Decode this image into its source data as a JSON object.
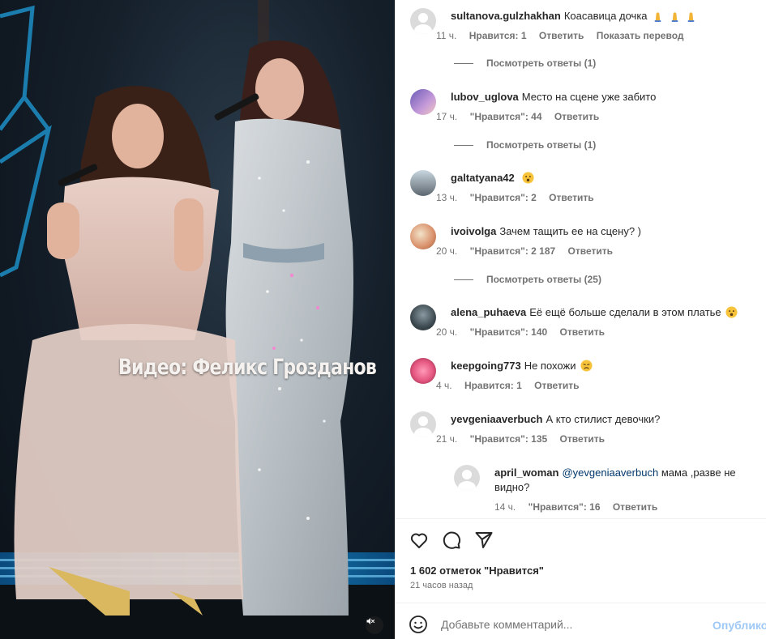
{
  "media": {
    "caption": "Видео: Феликс Грозданов"
  },
  "comments": [
    {
      "username": "sultanova.gulzhakhan",
      "text": "Коасавица дочка",
      "emoji": "praying-hands",
      "time": "11 ч.",
      "likes": "Нравится: 1",
      "reply_label": "Ответить",
      "translate_label": "Показать перевод",
      "view_replies": "Посмотреть ответы (1)"
    },
    {
      "username": "lubov_uglova",
      "text": "Место на сцене уже забито",
      "time": "17 ч.",
      "likes": "\"Нравится\": 44",
      "reply_label": "Ответить",
      "view_replies": "Посмотреть ответы (1)"
    },
    {
      "username": "galtatyana42",
      "text": "",
      "emoji": "surprised-face",
      "time": "13 ч.",
      "likes": "\"Нравится\": 2",
      "reply_label": "Ответить"
    },
    {
      "username": "ivoivolga",
      "text": "Зачем тащить ее на сцену? )",
      "time": "20 ч.",
      "likes": "\"Нравится\": 2 187",
      "reply_label": "Ответить",
      "view_replies": "Посмотреть ответы (25)"
    },
    {
      "username": "alena_puhaeva",
      "text": "Её ещё больше сделали в этом платье",
      "emoji": "surprised-face",
      "time": "20 ч.",
      "likes": "\"Нравится\": 140",
      "reply_label": "Ответить"
    },
    {
      "username": "keepgoing773",
      "text": "Не похожи",
      "emoji": "sad-face",
      "time": "4 ч.",
      "likes": "Нравится: 1",
      "reply_label": "Ответить"
    },
    {
      "username": "yevgeniaaverbuch",
      "text": "А кто стилист девочки?",
      "time": "21 ч.",
      "likes": "\"Нравится\": 135",
      "reply_label": "Ответить"
    },
    {
      "username": "april_woman",
      "mention": "@yevgeniaaverbuch",
      "text": "мама ,разве не видно?",
      "time": "14 ч.",
      "likes": "\"Нравится\": 16",
      "reply_label": "Ответить"
    }
  ],
  "actions": {
    "like_icon": "heart-icon",
    "comment_icon": "comment-icon",
    "share_icon": "send-icon"
  },
  "likes_count": "1 602 отметок \"Нравится\"",
  "posted_ago": "21 часов назад",
  "add_comment": {
    "placeholder": "Добавьте комментарий...",
    "post_label": "Опубликовать"
  },
  "colors": {
    "link_blue": "#00376b",
    "post_button_disabled": "#9ec8f5",
    "secondary_text": "#737373"
  }
}
